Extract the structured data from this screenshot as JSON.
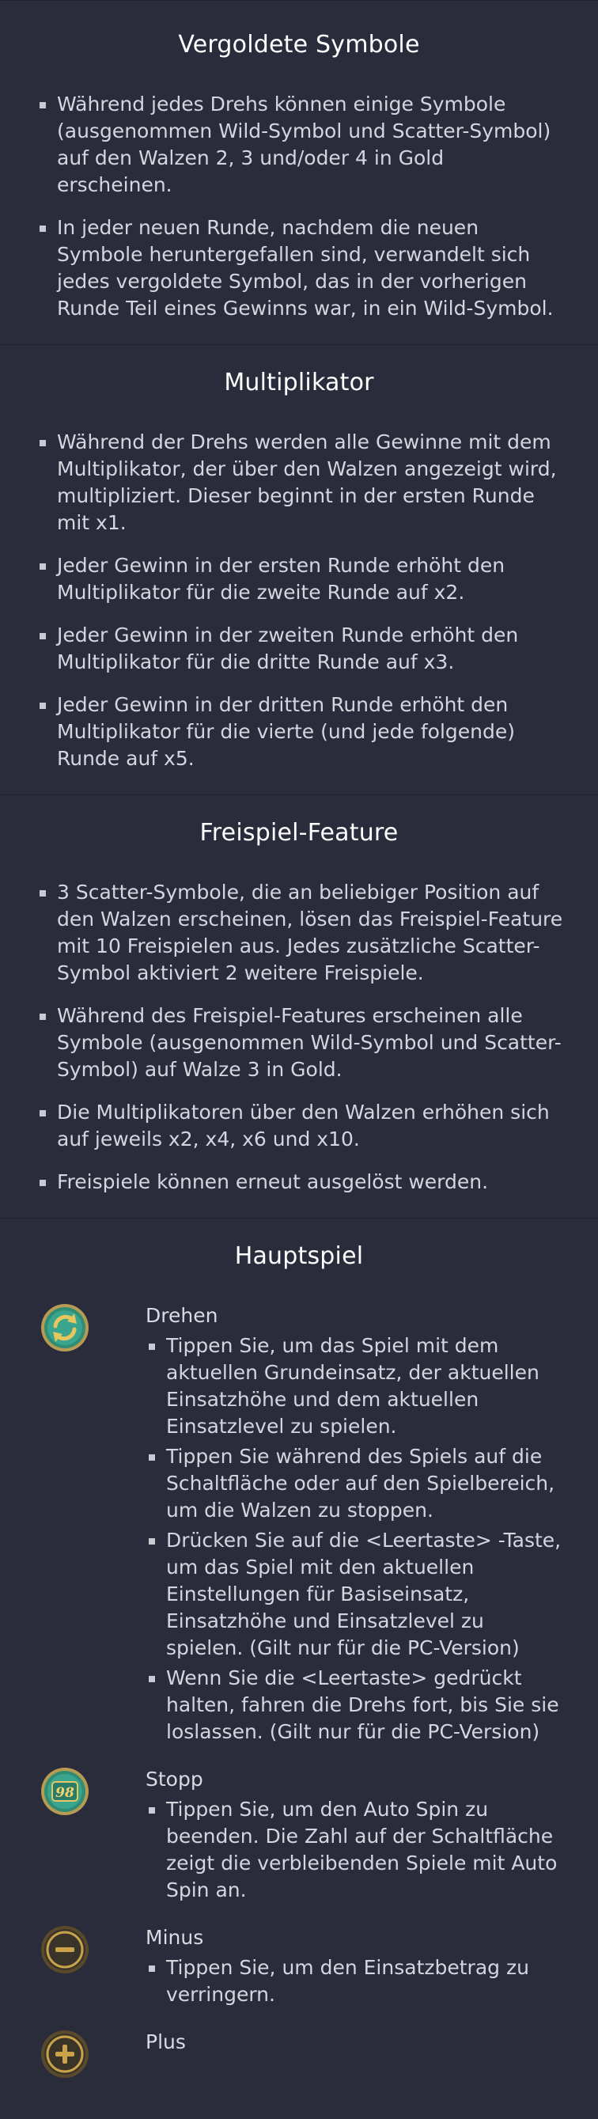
{
  "sections": [
    {
      "title": "Vergoldete Symbole",
      "items": [
        "Während jedes Drehs können einige Symbole (ausgenommen Wild-Symbol und Scatter-Symbol) auf den Walzen 2, 3 und/oder 4 in Gold erscheinen.",
        "In jeder neuen Runde, nachdem die neuen Symbole heruntergefallen sind, verwandelt sich jedes vergoldete Symbol, das in der vorherigen Runde Teil eines Gewinns war, in ein Wild-Symbol."
      ]
    },
    {
      "title": "Multiplikator",
      "items": [
        "Während der Drehs werden alle Gewinne mit dem Multiplikator, der über den Walzen angezeigt wird, multipliziert. Dieser beginnt in der ersten Runde mit x1.",
        "Jeder Gewinn in der ersten Runde erhöht den Multiplikator für die zweite Runde auf x2.",
        "Jeder Gewinn in der zweiten Runde erhöht den Multiplikator für die dritte Runde auf x3.",
        "Jeder Gewinn in der dritten Runde erhöht den Multiplikator für die vierte (und jede folgende) Runde auf x5."
      ]
    },
    {
      "title": "Freispiel-Feature",
      "items": [
        "3 Scatter-Symbole, die an beliebiger Position auf den Walzen erscheinen, lösen das Freispiel-Feature mit 10 Freispielen aus. Jedes zusätzliche Scatter-Symbol aktiviert 2 weitere Freispiele.",
        "Während des Freispiel-Features erscheinen alle Symbole (ausgenommen Wild-Symbol und Scatter-Symbol) auf Walze 3 in Gold.",
        "Die Multiplikatoren über den Walzen erhöhen sich auf jeweils x2, x4, x6 und x10.",
        "Freispiele können erneut ausgelöst werden."
      ]
    }
  ],
  "main_game": {
    "title": "Hauptspiel",
    "controls": [
      {
        "icon": "spin-icon",
        "name": "Drehen",
        "items": [
          "Tippen Sie, um das Spiel mit dem aktuellen Grundeinsatz, der aktuellen Einsatzhöhe und dem aktuellen Einsatzlevel zu spielen.",
          "Tippen Sie während des Spiels auf die Schaltfläche oder auf den Spielbereich, um die Walzen zu stoppen.",
          "Drücken Sie auf die <Leertaste> -Taste, um das Spiel mit den aktuellen Einstellungen für Basiseinsatz, Einsatzhöhe und Einsatzlevel zu spielen. (Gilt nur für die PC-Version)",
          "Wenn Sie die <Leertaste> gedrückt halten, fahren die Drehs fort, bis Sie sie loslassen. (Gilt nur für die PC-Version)"
        ]
      },
      {
        "icon": "autospin-stop-icon",
        "icon_text": "98",
        "name": "Stopp",
        "items": [
          "Tippen Sie, um den Auto Spin zu beenden. Die Zahl auf der Schaltfläche zeigt die verbleibenden Spiele mit Auto Spin an."
        ]
      },
      {
        "icon": "minus-icon",
        "name": "Minus",
        "items": [
          "Tippen Sie, um den Einsatzbetrag zu verringern."
        ]
      },
      {
        "icon": "plus-icon",
        "name": "Plus",
        "items": []
      }
    ]
  },
  "colors": {
    "background": "#2b2c3b",
    "title": "#ffffff",
    "text": "#d4d6de",
    "gold": "#c9a24a",
    "teal": "#3aa58e"
  }
}
